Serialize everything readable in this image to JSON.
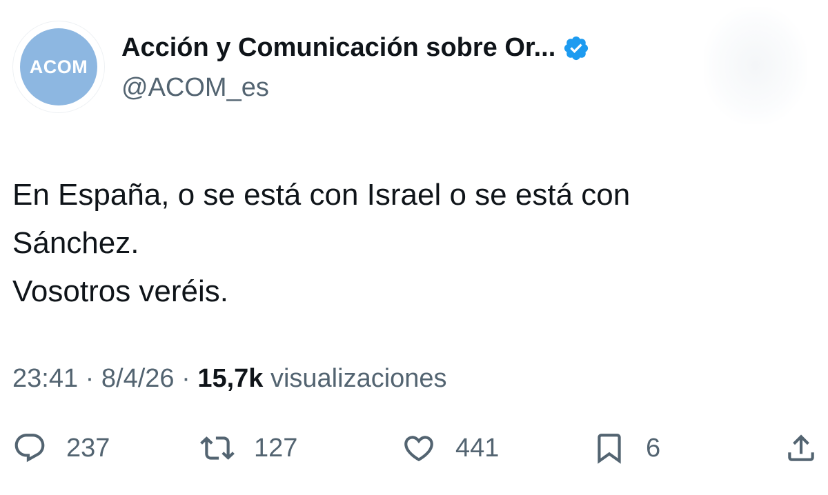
{
  "author": {
    "avatar_text": "ACOM",
    "name": "Acción y Comunicación sobre Or...",
    "handle": "@ACOM_es",
    "verified_icon": "verified-badge-icon"
  },
  "tweet": {
    "lines": [
      "En España, o se está con Israel o se está con",
      "Sánchez.",
      "Vosotros veréis."
    ],
    "time": "23:41",
    "separator": "·",
    "date": "8/4/26",
    "views_count": "15,7k",
    "views_label": "visualizaciones"
  },
  "actions": {
    "reply": {
      "icon": "reply-icon",
      "count": "237"
    },
    "retweet": {
      "icon": "retweet-icon",
      "count": "127"
    },
    "like": {
      "icon": "heart-icon",
      "count": "441"
    },
    "bookmark": {
      "icon": "bookmark-icon",
      "count": "6"
    },
    "share": {
      "icon": "share-icon"
    }
  },
  "colors": {
    "text": "#0f1419",
    "secondary": "#536471",
    "verified": "#1d9bf0",
    "avatar_bg": "#8db7e1"
  }
}
